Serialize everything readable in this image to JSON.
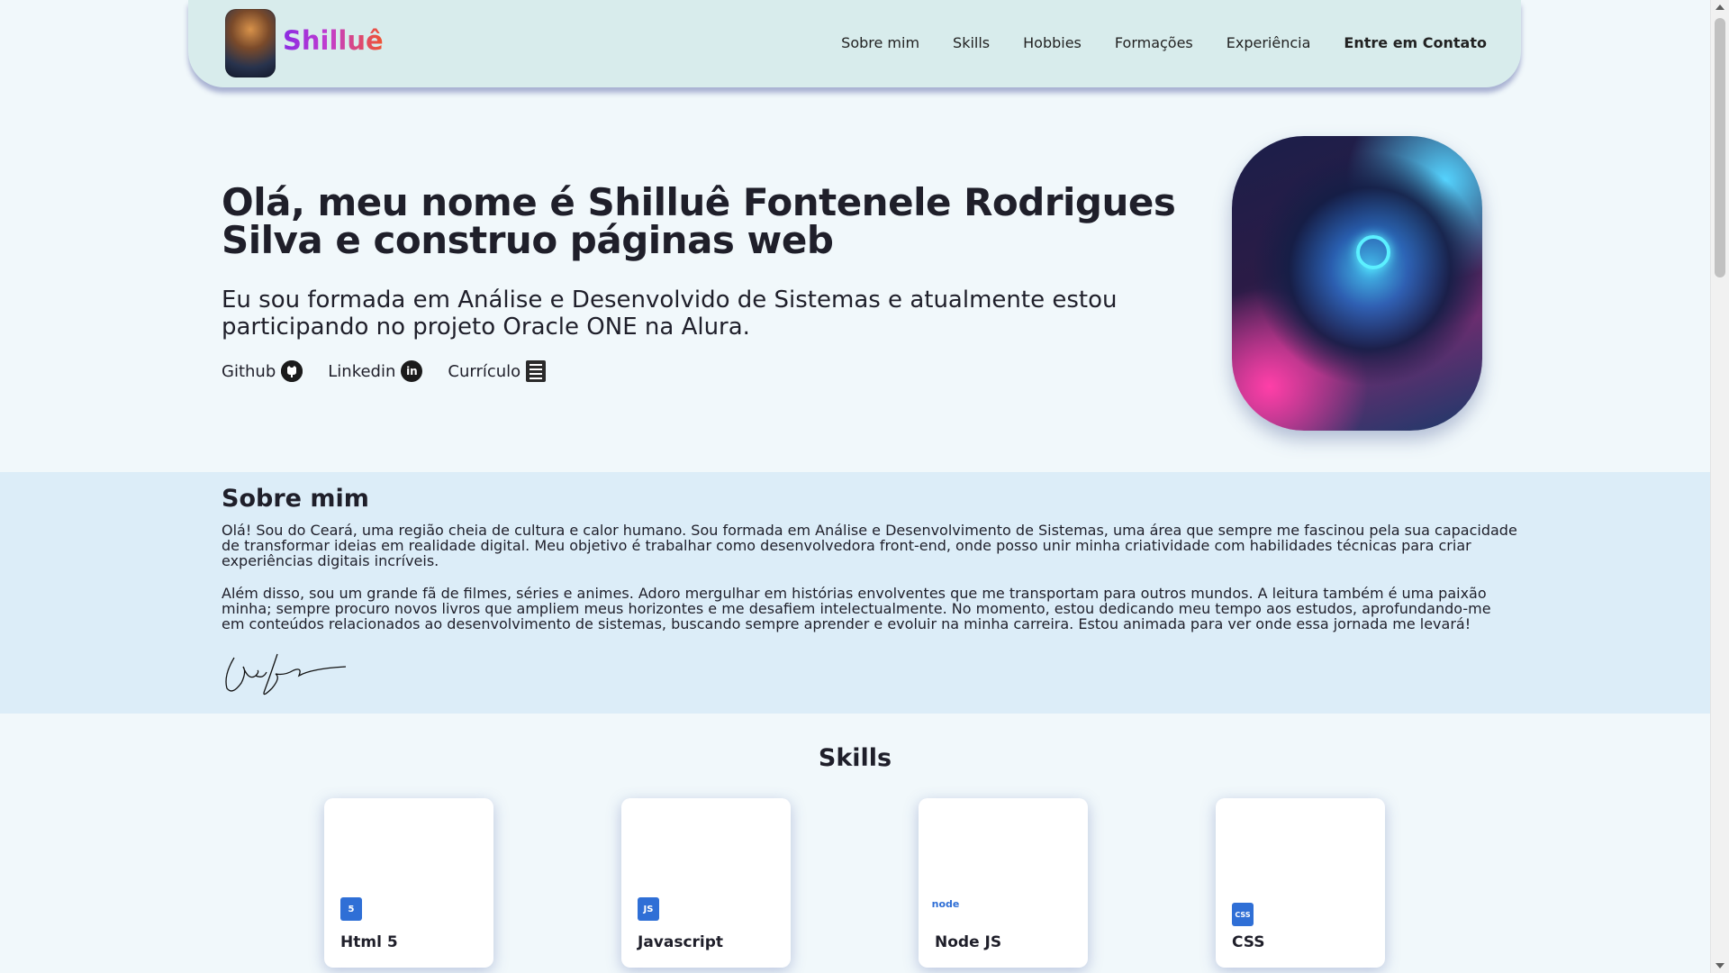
{
  "header": {
    "logo_text": "Shilluê",
    "nav": [
      "Sobre mim",
      "Skills",
      "Hobbies",
      "Formações",
      "Experiência"
    ],
    "contact_label": "Entre em Contato"
  },
  "hero": {
    "title": "Olá, meu nome é Shilluê Fontenele Rodrigues Silva e construo páginas web",
    "subtitle": "Eu sou formada em Análise e Desenvolvido de Sistemas e atualmente estou participando no projeto Oracle ONE na Alura.",
    "links": [
      {
        "label": "Github",
        "icon": "github-icon"
      },
      {
        "label": "Linkedin",
        "icon": "linkedin-icon"
      },
      {
        "label": "Currículo",
        "icon": "document-icon"
      }
    ]
  },
  "about": {
    "heading": "Sobre mim",
    "paragraph1": "Olá! Sou do Ceará, uma região cheia de cultura e calor humano. Sou formada em Análise e Desenvolvimento de Sistemas, uma área que sempre me fascinou pela sua capacidade de transformar ideias em realidade digital. Meu objetivo é trabalhar como desenvolvedora front-end, onde posso unir minha criatividade com habilidades técnicas para criar experiências digitais incríveis.",
    "paragraph2": "Além disso, sou um grande fã de filmes, séries e animes. Adoro mergulhar em histórias envolventes que me transportam para outros mundos. A leitura também é uma paixão minha; sempre procuro novos livros que ampliem meus horizontes e me desafiem intelectualmente. No momento, estou dedicando meu tempo aos estudos, aprofundando-me em conteúdos relacionados ao desenvolvimento de sistemas, buscando sempre aprender e evoluir na minha carreira. Estou animada para ver onde essa jornada me levará!"
  },
  "skills": {
    "heading": "Skills",
    "cards": [
      {
        "label": "Html 5",
        "icon": "html5-icon",
        "icon_text": "5",
        "color": "#2f6fd6"
      },
      {
        "label": "Javascript",
        "icon": "javascript-icon",
        "icon_text": "JS",
        "color": "#2f6fd6"
      },
      {
        "label": "Node JS",
        "icon": "nodejs-icon",
        "icon_text": "node",
        "color": "#2f6fd6"
      },
      {
        "label": "CSS",
        "icon": "css-icon",
        "icon_text": "CSS",
        "color": "#2f6fd6"
      }
    ]
  }
}
